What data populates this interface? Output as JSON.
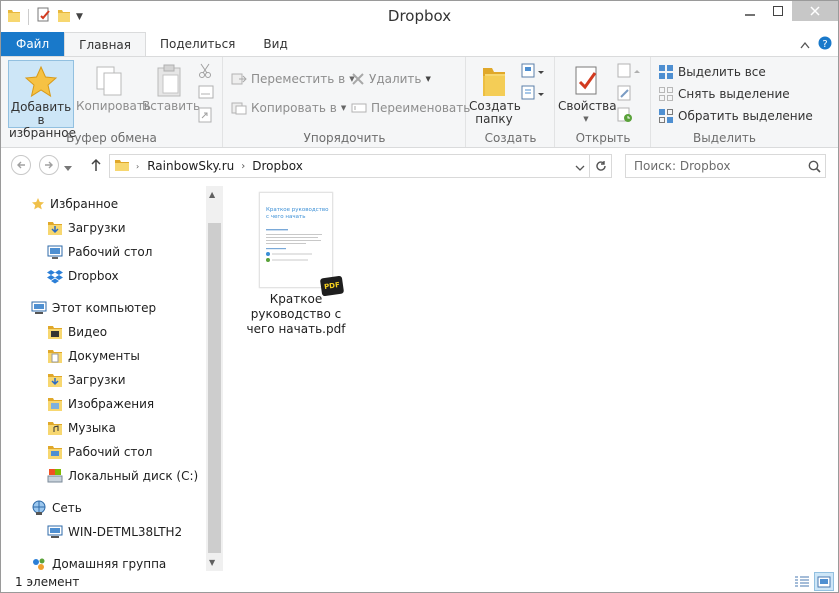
{
  "window": {
    "title": "Dropbox"
  },
  "ribbon_tabs": {
    "file": "Файл",
    "home": "Главная",
    "share": "Поделиться",
    "view": "Вид"
  },
  "ribbon": {
    "clipboard": {
      "label": "Буфер обмена",
      "pin": "Добавить в избранное",
      "pin_line1": "Добавить в",
      "pin_line2": "избранное",
      "copy": "Копировать",
      "paste": "Вставить"
    },
    "organize": {
      "label": "Упорядочить",
      "move_to": "Переместить в",
      "copy_to": "Копировать в",
      "delete": "Удалить",
      "rename": "Переименовать"
    },
    "new": {
      "label": "Создать",
      "new_folder_line1": "Создать",
      "new_folder_line2": "папку"
    },
    "open": {
      "label": "Открыть",
      "properties": "Свойства"
    },
    "select": {
      "label": "Выделить",
      "select_all": "Выделить все",
      "select_none": "Снять выделение",
      "invert": "Обратить выделение"
    }
  },
  "address": {
    "crumbs": [
      "RainbowSky.ru",
      "Dropbox"
    ],
    "search_placeholder": "Поиск: Dropbox"
  },
  "nav": {
    "favorites": "Избранное",
    "fav_items": [
      "Загрузки",
      "Рабочий стол",
      "Dropbox"
    ],
    "computer": "Этот компьютер",
    "computer_items": [
      "Видео",
      "Документы",
      "Загрузки",
      "Изображения",
      "Музыка",
      "Рабочий стол",
      "Локальный диск (C:)"
    ],
    "network": "Сеть",
    "network_items": [
      "WIN-DETML38LTH2"
    ],
    "homegroup": "Домашняя группа"
  },
  "files": [
    {
      "name": "Краткое руководство с чего начать.pdf",
      "name_lines": [
        "Краткое",
        "руководство с",
        "чего начать.pdf"
      ],
      "thumb_title_lines": [
        "Краткое руководство",
        "с чего начать"
      ],
      "badge": "PDF"
    }
  ],
  "status": {
    "count": "1 элемент"
  },
  "colors": {
    "accent": "#1979ca",
    "selection": "#cde6f7"
  }
}
